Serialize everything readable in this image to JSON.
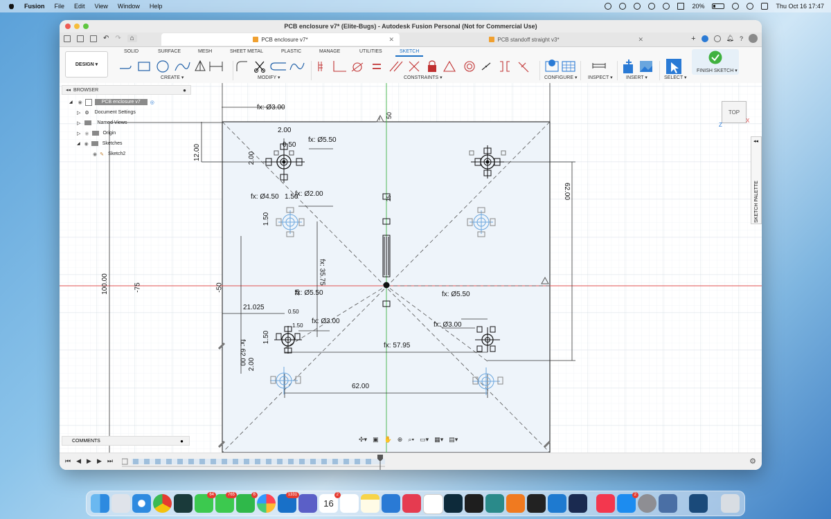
{
  "menubar": {
    "app_name": "Fusion",
    "menus": [
      "File",
      "Edit",
      "View",
      "Window",
      "Help"
    ],
    "battery_percent": "20%",
    "clock": "Thu Oct 16  17:47"
  },
  "window": {
    "title": "PCB enclosure v7* (Elite-Bugs) - Autodesk Fusion Personal (Not for Commercial Use)",
    "tabs": [
      {
        "label": "PCB enclosure v7*",
        "active": true
      },
      {
        "label": "PCB standoff straight v3*",
        "active": false
      }
    ],
    "notification_count": "2"
  },
  "ribbon": {
    "workspace": "DESIGN",
    "tabs": [
      "SOLID",
      "SURFACE",
      "MESH",
      "SHEET METAL",
      "PLASTIC",
      "MANAGE",
      "UTILITIES",
      "SKETCH"
    ],
    "active_tab": "SKETCH",
    "groups": [
      "CREATE",
      "MODIFY",
      "CONSTRAINTS",
      "CONFIGURE",
      "INSPECT",
      "INSERT",
      "SELECT",
      "FINISH SKETCH"
    ]
  },
  "browser": {
    "header": "BROWSER",
    "items": [
      {
        "label": "PCB enclosure v7",
        "icon": "document-icon"
      },
      {
        "label": "Document Settings",
        "icon": "gear-icon"
      },
      {
        "label": "Named Views",
        "icon": "folder-icon"
      },
      {
        "label": "Origin",
        "icon": "folder-icon"
      },
      {
        "label": "Sketches",
        "icon": "folder-icon"
      },
      {
        "label": "Sketch2",
        "icon": "sketch-icon"
      }
    ]
  },
  "comments_label": "COMMENTS",
  "viewcube_label": "TOP",
  "sketch_palette_label": "SKETCH PALETTE",
  "axis_labels": {
    "x": "X",
    "z": "Z"
  },
  "ruler": {
    "vertical_labels": [
      "100.00",
      "-75",
      "-50"
    ],
    "top_label": "50",
    "center_labels": [
      "25",
      "25"
    ]
  },
  "dimensions": {
    "d1": "fx: Ø3.00",
    "d2": "2.00",
    "d3": "fx: Ø5.50",
    "d4": "12.00",
    "d5": "2.00",
    "d6": "0.50",
    "d7": "fx: Ø4.50",
    "d8": "1.50",
    "d9": "fx: Ø2.00",
    "d10": "1.50",
    "d11": "fx: 35.75",
    "d12": "62.00",
    "d13": "21.025",
    "d14": "fx: Ø5.50",
    "d15": "fx: Ø3.00",
    "d16": "1.50",
    "d17": "fx: 62.00",
    "d18": "2.00",
    "d19": "fx: 57.95",
    "d20": "62.00",
    "d21": "fx: Ø5.50",
    "d22": "fx: Ø3.00",
    "d23": "1.50",
    "d24": "0.50"
  },
  "dock_badges": {
    "phone": "64",
    "messages": "765",
    "facetime": "6",
    "outlook": "1331",
    "calendar_date": "16",
    "calendar_badge": "2",
    "appstore": "2"
  },
  "colors": {
    "accent": "#1a6fc4",
    "sketch_region": "#eef4fa",
    "x_axis": "#e05050",
    "y_axis": "#3cb043"
  }
}
